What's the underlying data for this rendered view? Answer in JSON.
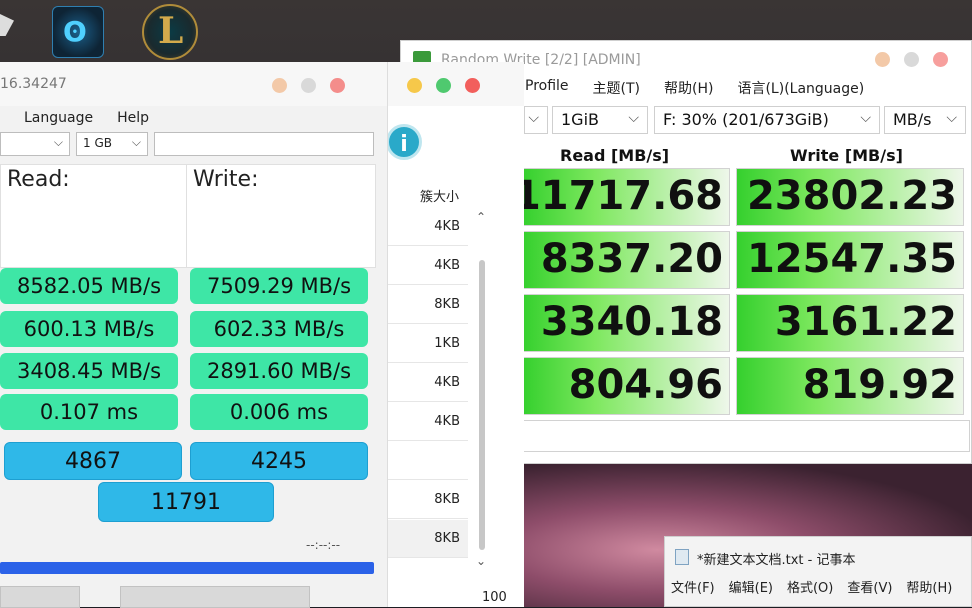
{
  "cdm": {
    "title": "Random Write [2/2] [ADMIN]",
    "menu": [
      "Profile",
      "主题(T)",
      "帮助(H)",
      "语言(L)(Language)"
    ],
    "size": "1GiB",
    "drive": "F: 30% (201/673GiB)",
    "unit": "MB/s",
    "read_header": "Read [MB/s]",
    "write_header": "Write [MB/s]",
    "rows": [
      {
        "read": "11717.68",
        "write": "23802.23"
      },
      {
        "read": "8337.20",
        "write": "12547.35"
      },
      {
        "read": "3340.18",
        "write": "3161.22"
      },
      {
        "read": "804.96",
        "write": "819.92"
      }
    ]
  },
  "mid": {
    "col_header": "簇大小",
    "blocks": [
      "4KB",
      "4KB",
      "8KB",
      "1KB",
      "4KB",
      "4KB",
      "",
      "8KB",
      "8KB"
    ],
    "scroll_value": "100"
  },
  "as": {
    "title": "16.34247",
    "menu": [
      "Language",
      "Help"
    ],
    "size": "1 GB",
    "read_label": "Read:",
    "write_label": "Write:",
    "read": [
      "8582.05 MB/s",
      "600.13 MB/s",
      "3408.45 MB/s",
      "0.107 ms"
    ],
    "write": [
      "7509.29 MB/s",
      "602.33 MB/s",
      "2891.60 MB/s",
      "0.006 ms"
    ],
    "score_read": "4867",
    "score_write": "4245",
    "score_total": "11791",
    "time": "--:--:--"
  },
  "notepad": {
    "title": "*新建文本文档.txt - 记事本",
    "menu": [
      "文件(F)",
      "编辑(E)",
      "格式(O)",
      "查看(V)",
      "帮助(H)"
    ]
  }
}
